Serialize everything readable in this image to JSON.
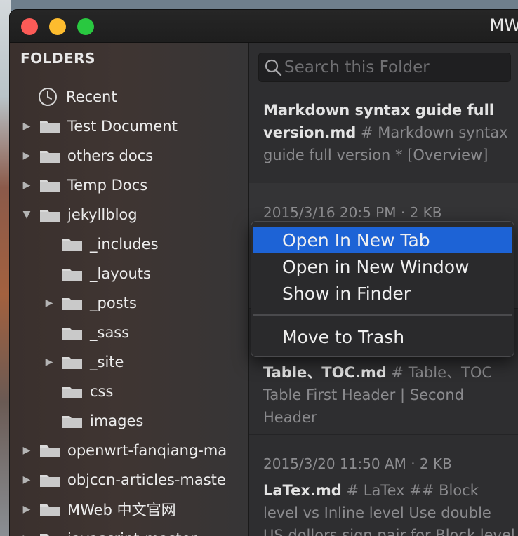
{
  "window": {
    "title": "MW"
  },
  "sidebar": {
    "header": "FOLDERS",
    "items": [
      {
        "label": "Recent",
        "icon": "clock-icon",
        "disclosure": ""
      },
      {
        "label": "Test Document",
        "icon": "folder-icon",
        "disclosure": "▶"
      },
      {
        "label": "others docs",
        "icon": "folder-icon",
        "disclosure": "▶"
      },
      {
        "label": "Temp Docs",
        "icon": "folder-icon",
        "disclosure": "▶"
      },
      {
        "label": "jekyllblog",
        "icon": "folder-icon",
        "disclosure": "▼"
      },
      {
        "label": "_includes",
        "icon": "folder-icon",
        "disclosure": ""
      },
      {
        "label": "_layouts",
        "icon": "folder-icon",
        "disclosure": ""
      },
      {
        "label": "_posts",
        "icon": "folder-icon",
        "disclosure": "▶"
      },
      {
        "label": "_sass",
        "icon": "folder-icon",
        "disclosure": ""
      },
      {
        "label": "_site",
        "icon": "folder-icon",
        "disclosure": "▶"
      },
      {
        "label": "css",
        "icon": "folder-icon",
        "disclosure": ""
      },
      {
        "label": "images",
        "icon": "folder-icon",
        "disclosure": ""
      },
      {
        "label": "openwrt-fanqiang-ma",
        "icon": "folder-icon",
        "disclosure": "▶"
      },
      {
        "label": "objccn-articles-maste",
        "icon": "folder-icon",
        "disclosure": "▶"
      },
      {
        "label": "MWeb 中文官网",
        "icon": "folder-icon",
        "disclosure": "▶"
      },
      {
        "label": "javascript-master",
        "icon": "folder-icon",
        "disclosure": "▶"
      }
    ]
  },
  "search": {
    "placeholder": "Search this Folder"
  },
  "notes": [
    {
      "meta": "",
      "title": "Markdown syntax guide full version.md",
      "excerpt": "# Markdown syntax guide full version  * [Overview]"
    },
    {
      "meta": "2015/3/16 20:5 PM   · 2 KB",
      "title": "",
      "excerpt": ""
    },
    {
      "meta": "",
      "title": "Table、TOC.md",
      "excerpt": "# Table、TOC Table  First Header | Second Header"
    },
    {
      "meta": "2015/3/20 11:50 AM   · 2 KB",
      "title": "LaTex.md",
      "excerpt": "# LaTex  ## Block level vs Inline level  Use double US dollors sign pair for Block level"
    }
  ],
  "context_menu": {
    "items": [
      {
        "label": "Open In New Tab",
        "highlighted": true
      },
      {
        "label": "Open in New Window",
        "highlighted": false
      },
      {
        "label": "Show in Finder",
        "highlighted": false
      },
      {
        "label": "Move to Trash",
        "highlighted": false
      }
    ],
    "highlight_color": "#1d63d6"
  },
  "colors": {
    "traffic_red": "#fc5b57",
    "traffic_yellow": "#fdbc2e",
    "traffic_green": "#29c840"
  }
}
